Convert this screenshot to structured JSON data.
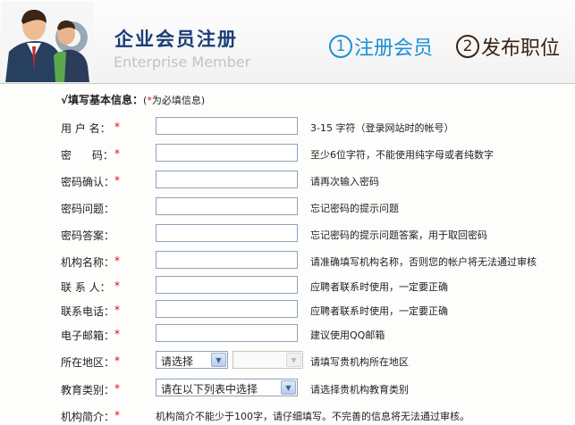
{
  "header": {
    "title": "企业会员注册",
    "subtitle": "Enterprise Member",
    "steps": [
      {
        "num": "1",
        "label": "注册会员"
      },
      {
        "num": "2",
        "label": "发布职位"
      }
    ]
  },
  "section": {
    "check": "√",
    "title": "填写基本信息：",
    "note_open": "(",
    "note_star": "*",
    "note_text": "为必填信息)"
  },
  "fields": {
    "username": {
      "label": "用 户 名：",
      "required": "*",
      "hint": "3-15 字符（登录网站时的帐号）"
    },
    "password": {
      "label": "密      码：",
      "required": "*",
      "hint": "至少6位字符，不能使用纯字母或者纯数字"
    },
    "confirm": {
      "label": "密码确认：",
      "required": "*",
      "hint": "请再次输入密码"
    },
    "question": {
      "label": "密码问题：",
      "hint": "忘记密码的提示问题"
    },
    "answer": {
      "label": "密码答案：",
      "hint": "忘记密码的提示问题答案，用于取回密码"
    },
    "org_name": {
      "label": "机构名称：",
      "required": "*",
      "hint": "请准确填写机构名称，否则您的帐户将无法通过审核"
    },
    "contact": {
      "label": "联 系 人：",
      "required": "*",
      "hint": "应聘者联系时使用，一定要正确"
    },
    "phone": {
      "label": "联系电话：",
      "required": "*",
      "hint": "应聘者联系时使用，一定要正确"
    },
    "email": {
      "label": "电子邮箱：",
      "required": "*",
      "hint": "建议使用QQ邮箱"
    },
    "region": {
      "label": "所在地区：",
      "required": "*",
      "select1": "请选择",
      "select2": "",
      "hint": "请填写贵机构所在地区"
    },
    "edu_type": {
      "label": "教育类别：",
      "required": "*",
      "select": "请在以下列表中选择",
      "hint": "请选择贵机构教育类别"
    },
    "intro": {
      "label": "机构简介：",
      "required": "*",
      "hint": "机构简介不能少于100字，请仔细填写。不完善的信息将无法通过审核。"
    }
  },
  "colors": {
    "accent": "#1d8fd6",
    "title": "#1a3d78",
    "required": "#d01010"
  }
}
